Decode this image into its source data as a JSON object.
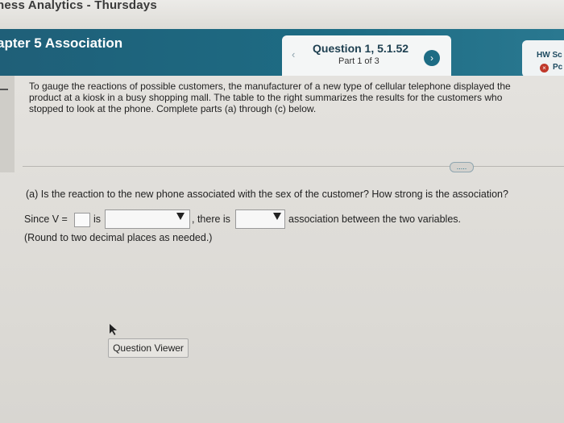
{
  "window": {
    "title": "ness Analytics - Thursdays"
  },
  "header": {
    "chapter": "apter 5 Association",
    "prev_icon": "chevron-left-icon",
    "question_title": "Question 1, 5.1.52",
    "question_part": "Part 1 of 3",
    "next_icon": "chevron-right-icon",
    "hw_label": "HW Sc",
    "hw_status_icon": "x-circle-icon",
    "hw_status_text": "Pc"
  },
  "problem": {
    "intro": "To gauge the reactions of possible customers, the manufacturer of a new type of cellular telephone displayed the product at a kiosk in a busy shopping mall. The table to the right summarizes the results for the customers who stopped to look at the phone. Complete parts (a) through (c) below.",
    "more_label": "....."
  },
  "part_a": {
    "question": "(a) Is the reaction to the new phone associated with the sex of the customer? How strong is the association?",
    "since_label": "Since V =",
    "v_value": "",
    "is_label": "is",
    "dropdown1_value": "",
    "there_is_label": ", there is",
    "dropdown2_value": "",
    "association_label": "association between the two variables.",
    "round_note": "(Round to two decimal places as needed.)"
  },
  "footer": {
    "question_viewer": "Question Viewer"
  },
  "colors": {
    "header_bg": "#1f5f78",
    "accent": "#1d6c84",
    "error": "#c0392b"
  }
}
